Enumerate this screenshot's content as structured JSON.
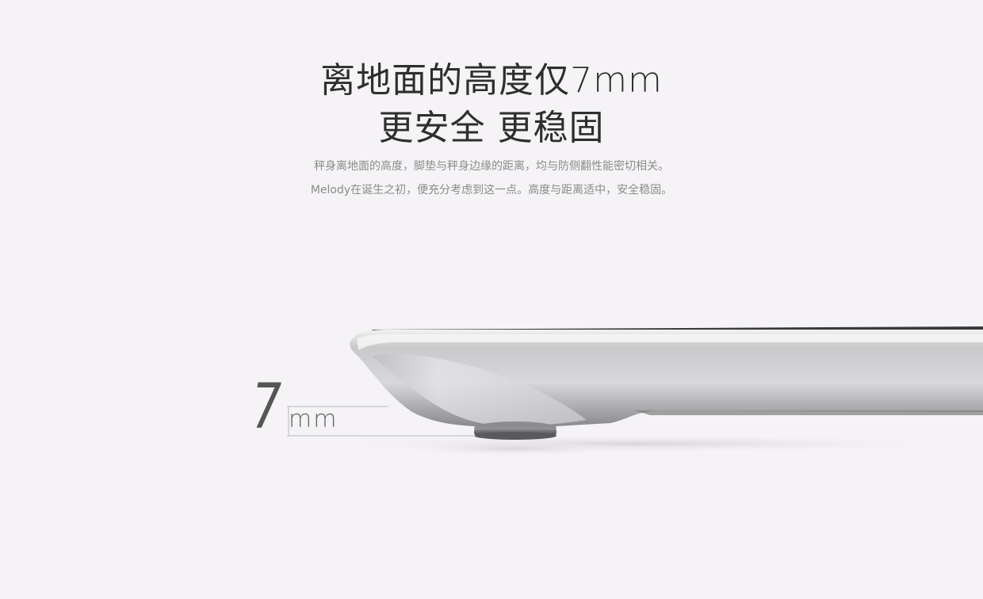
{
  "headline": {
    "line1": "离地面的高度仅7mm",
    "line2": "更安全 更稳固"
  },
  "description": {
    "line1": "秤身离地面的高度，脚垫与秤身边缘的距离，均与防侧翻性能密切相关。",
    "line2": "Melody在诞生之初，便充分考虑到这一点。高度与距离适中，安全稳固。"
  },
  "measurement": {
    "number": "7",
    "unit": "mm"
  },
  "colors": {
    "background": "#f5f3f6",
    "headline": "#2e2e2e",
    "body": "#8b8b8b"
  }
}
